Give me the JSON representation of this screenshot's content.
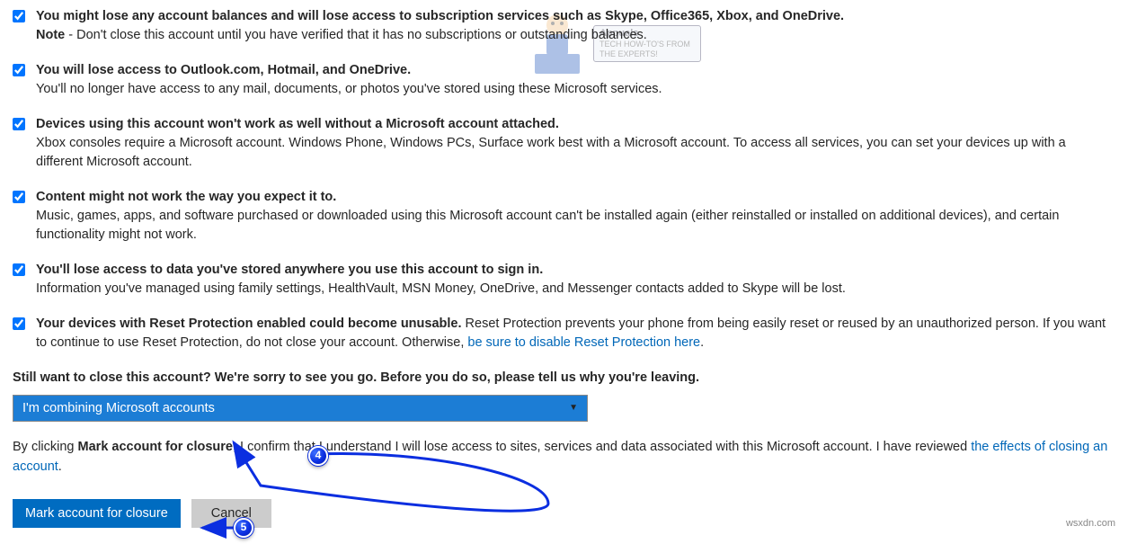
{
  "watermark": {
    "brand": "Appuals",
    "tagline1": "TECH HOW-TO'S FROM",
    "tagline2": "THE EXPERTS!"
  },
  "items": [
    {
      "heading": "You might lose any account balances and will lose access to subscription services such as Skype, Office365, Xbox, and OneDrive.",
      "note_label": "Note",
      "note_body": " - Don't close this account until you have verified that it has no subscriptions or outstanding balances."
    },
    {
      "heading": "You will lose access to Outlook.com, Hotmail, and OneDrive.",
      "body": "You'll no longer have access to any mail, documents, or photos you've stored using these Microsoft services."
    },
    {
      "heading": "Devices using this account won't work as well without a Microsoft account attached.",
      "body": "Xbox consoles require a Microsoft account. Windows Phone, Windows PCs, Surface work best with a Microsoft account. To access all services, you can set your devices up with a different Microsoft account."
    },
    {
      "heading": "Content might not work the way you expect it to.",
      "body": "Music, games, apps, and software purchased or downloaded using this Microsoft account can't be installed again (either reinstalled or installed on additional devices), and certain functionality might not work."
    },
    {
      "heading": "You'll lose access to data you've stored anywhere you use this account to sign in.",
      "body": "Information you've managed using family settings, HealthVault, MSN Money, OneDrive, and Messenger contacts added to Skype will be lost."
    },
    {
      "heading_inline": "Your devices with Reset Protection enabled could become unusable.",
      "body_inline": " Reset Protection prevents your phone from being easily reset or reused by an unauthorized person. If you want to continue to use Reset Protection, do not close your account. Otherwise, ",
      "link": "be sure to disable Reset Protection here",
      "suffix": "."
    }
  ],
  "still_prompt": "Still want to close this account? We're sorry to see you go. Before you do so, please tell us why you're leaving.",
  "dropdown": {
    "selected": "I'm combining Microsoft accounts"
  },
  "confirm": {
    "prefix": "By clicking ",
    "bold": "Mark account for closure",
    "mid": ", I confirm that I understand I will lose access to sites, services and data associated with this Microsoft account. I have reviewed ",
    "link": "the effects of closing an account",
    "suffix": "."
  },
  "buttons": {
    "primary": "Mark account for closure",
    "secondary": "Cancel"
  },
  "annotations": {
    "n4": "4",
    "n5": "5"
  },
  "footer_mark": "wsxdn.com"
}
